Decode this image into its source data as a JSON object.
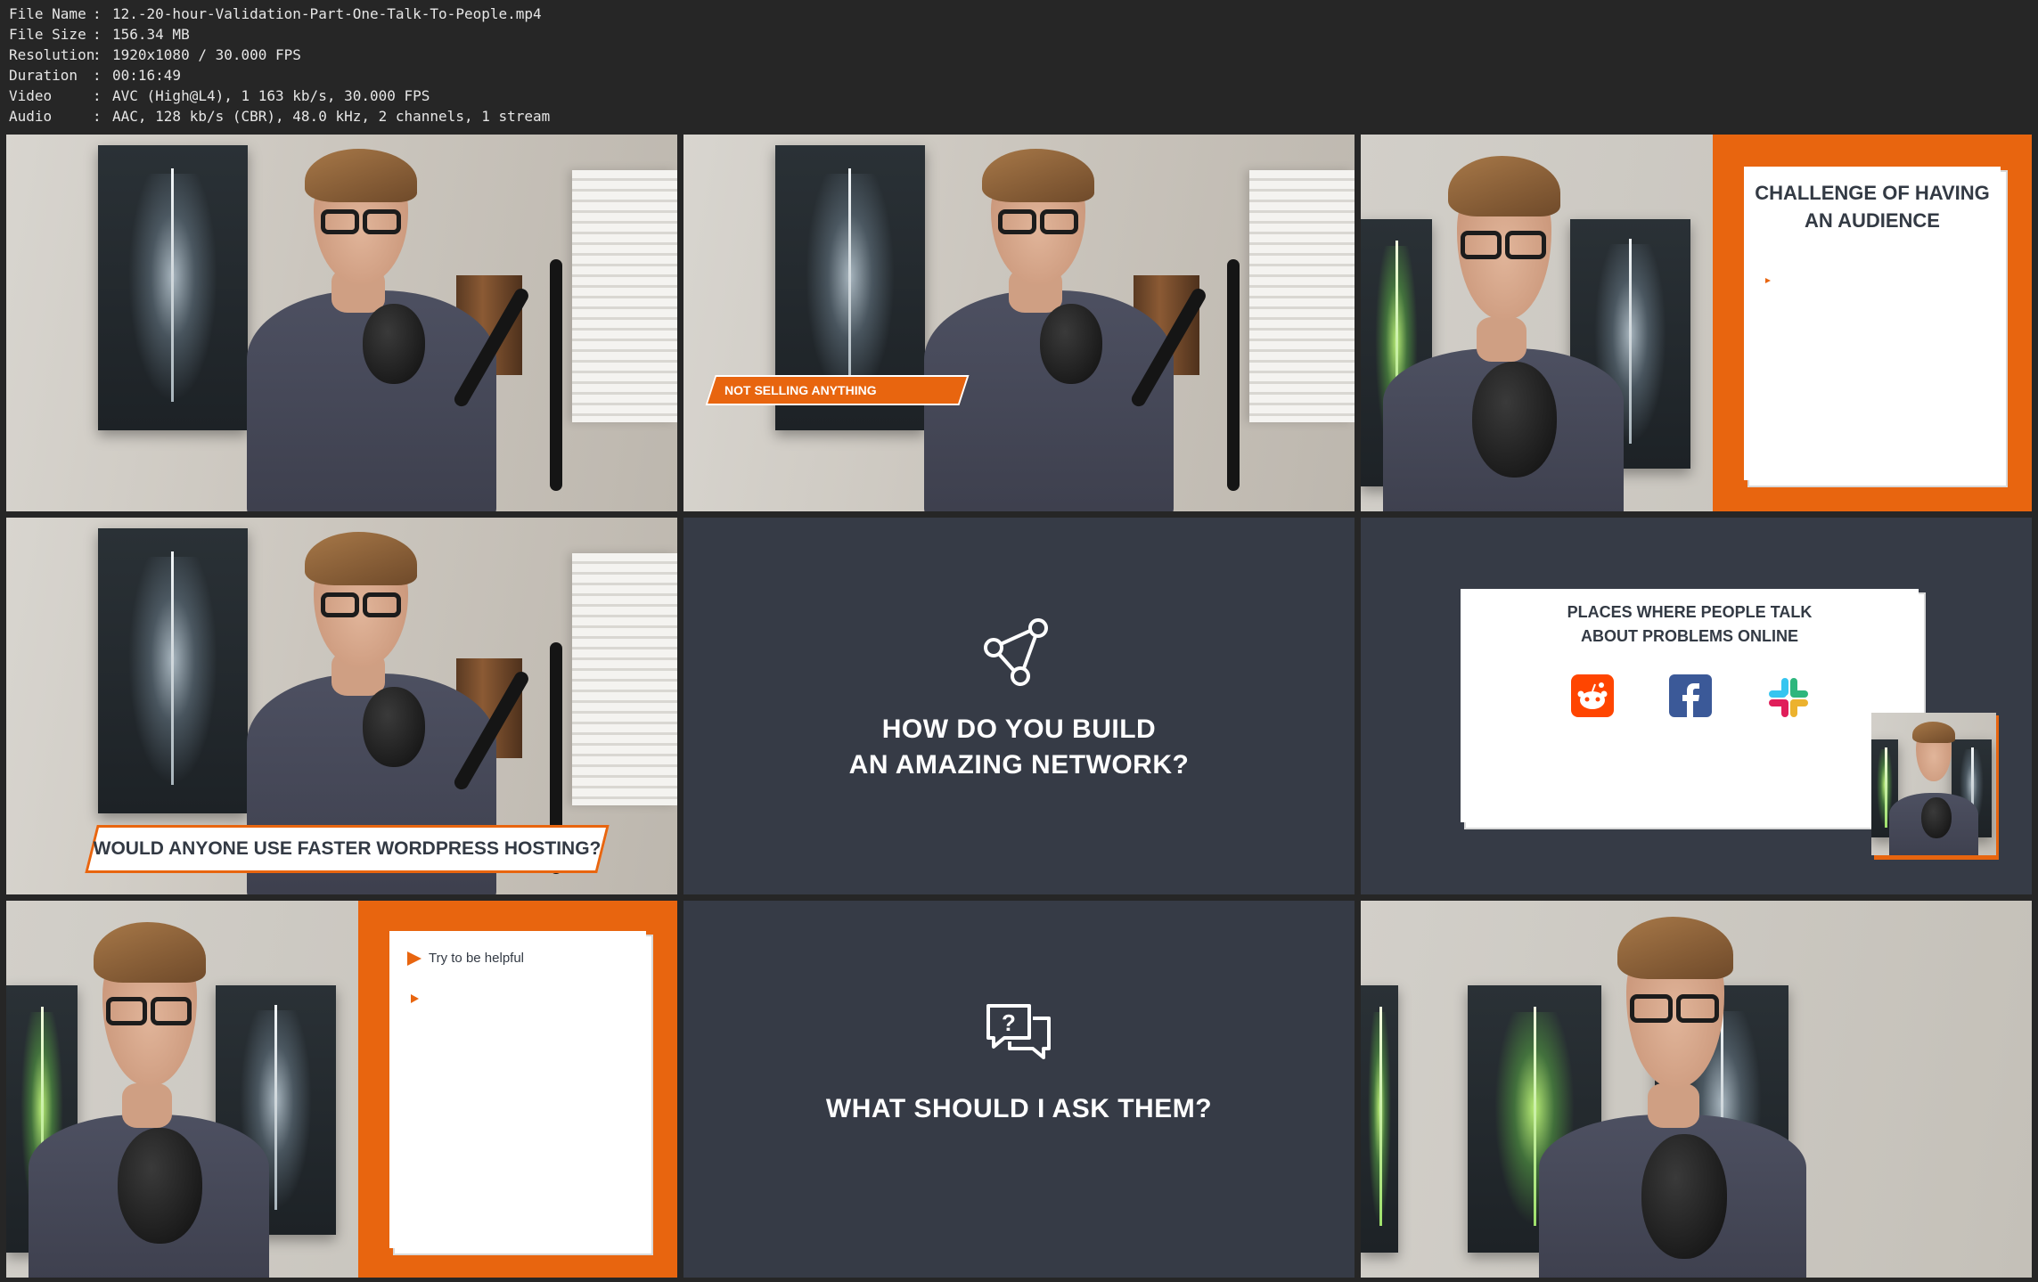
{
  "meta": [
    {
      "key": "File Name",
      "value": "12.-20-hour-Validation-Part-One-Talk-To-People.mp4"
    },
    {
      "key": "File Size",
      "value": "156.34 MB"
    },
    {
      "key": "Resolution",
      "value": "1920x1080 / 30.000 FPS"
    },
    {
      "key": "Duration",
      "value": "00:16:49"
    },
    {
      "key": "Video",
      "value": "AVC (High@L4), 1 163 kb/s, 30.000 FPS"
    },
    {
      "key": "Audio",
      "value": "AAC, 128 kb/s (CBR), 48.0 kHz, 2 channels, 1 stream"
    }
  ],
  "frames": {
    "f2": {
      "lower_third": "NOT SELLING ANYTHING"
    },
    "f3": {
      "card_title": "CHALLENGE OF HAVING AN AUDIENCE"
    },
    "f4": {
      "lower_third": "WOULD ANYONE USE FASTER WORDPRESS HOSTING?"
    },
    "f5": {
      "line1": "HOW DO YOU BUILD",
      "line2": "AN AMAZING NETWORK?"
    },
    "f6": {
      "line1": "PLACES WHERE PEOPLE TALK",
      "line2": "ABOUT PROBLEMS ONLINE",
      "icons": [
        "reddit-icon",
        "facebook-icon",
        "slack-icon"
      ]
    },
    "f7": {
      "bullet1": "Try to be helpful"
    },
    "f8": {
      "line1": "WHAT SHOULD I ASK THEM?"
    }
  },
  "colors": {
    "accent": "#e8650f",
    "dark_slate": "#363b46",
    "background": "#262626"
  }
}
